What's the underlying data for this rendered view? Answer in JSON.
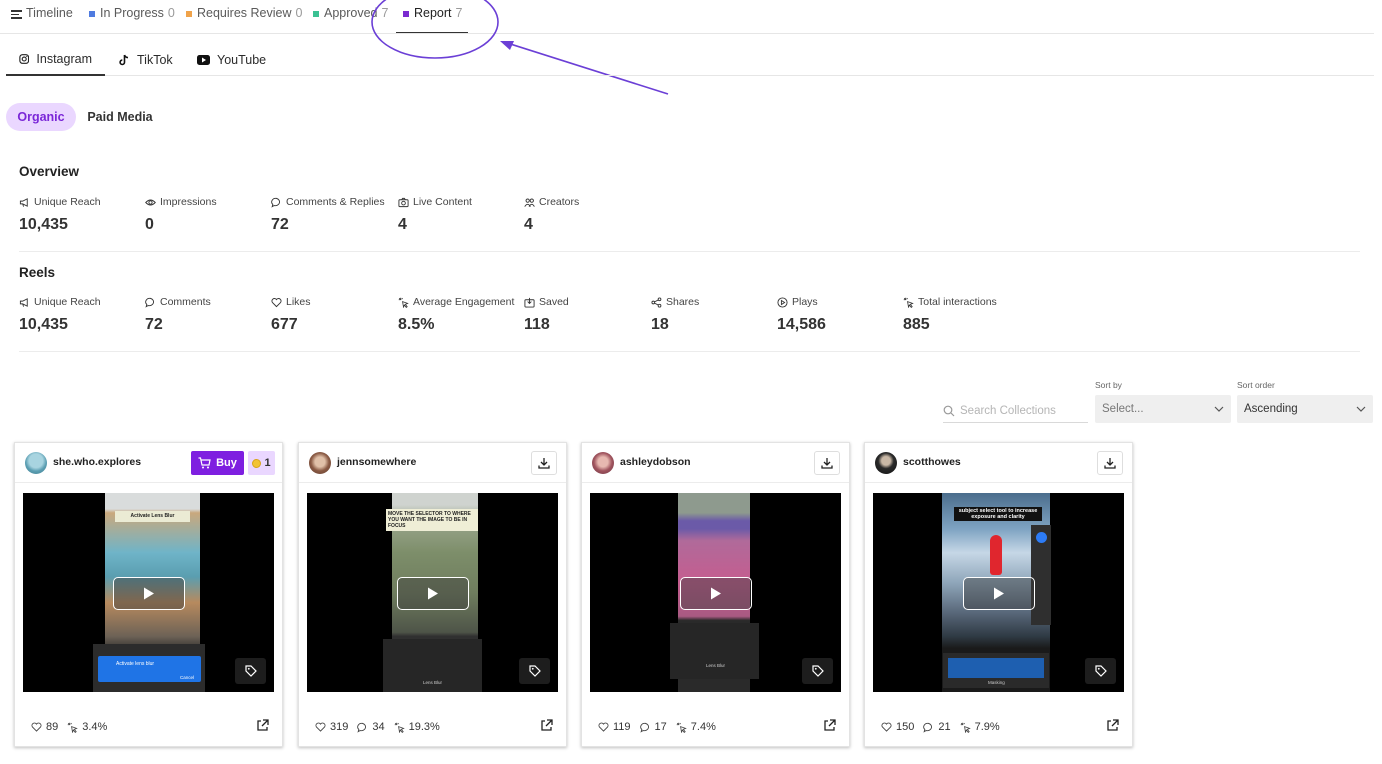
{
  "top_tabs": [
    {
      "label": "Timeline",
      "count": ""
    },
    {
      "label": "In Progress",
      "count": "0",
      "color": "#4f7be0"
    },
    {
      "label": "Requires Review",
      "count": "0",
      "color": "#f0a34a"
    },
    {
      "label": "Approved",
      "count": "7",
      "color": "#3bc193"
    },
    {
      "label": "Report",
      "count": "7",
      "color": "#7a2ad0"
    }
  ],
  "platform_tabs": [
    "Instagram",
    "TikTok",
    "YouTube"
  ],
  "media_pills": [
    "Organic",
    "Paid Media"
  ],
  "overview": {
    "title": "Overview",
    "metrics": [
      {
        "label": "Unique Reach",
        "value": "10,435",
        "icon": "megaphone-icon"
      },
      {
        "label": "Impressions",
        "value": "0",
        "icon": "eye-icon"
      },
      {
        "label": "Comments & Replies",
        "value": "72",
        "icon": "comment-icon"
      },
      {
        "label": "Live Content",
        "value": "4",
        "icon": "camera-icon"
      },
      {
        "label": "Creators",
        "value": "4",
        "icon": "people-icon"
      }
    ]
  },
  "reels": {
    "title": "Reels",
    "metrics": [
      {
        "label": "Unique Reach",
        "value": "10,435",
        "icon": "megaphone-icon"
      },
      {
        "label": "Comments",
        "value": "72",
        "icon": "comment-icon"
      },
      {
        "label": "Likes",
        "value": "677",
        "icon": "heart-icon"
      },
      {
        "label": "Average Engagement",
        "value": "8.5%",
        "icon": "click-icon"
      },
      {
        "label": "Saved",
        "value": "118",
        "icon": "save-icon"
      },
      {
        "label": "Shares",
        "value": "18",
        "icon": "share-icon"
      },
      {
        "label": "Plays",
        "value": "14,586",
        "icon": "play-circle-icon"
      },
      {
        "label": "Total interactions",
        "value": "885",
        "icon": "click-icon"
      }
    ]
  },
  "filters": {
    "search_placeholder": "Search Collections",
    "sort_by_label": "Sort by",
    "sort_by_value": "Select...",
    "sort_order_label": "Sort order",
    "sort_order_value": "Ascending"
  },
  "cards": [
    {
      "username": "she.who.explores",
      "buy_label": "Buy",
      "coin_count": "1",
      "likes": "89",
      "comments": "",
      "engagement": "3.4%",
      "overlay": "Activate Lens Blur",
      "overlay2": "Activate lens blur",
      "overlay3": "Cancel",
      "avatar_color": "#7bb4c8"
    },
    {
      "username": "jennsomewhere",
      "likes": "319",
      "comments": "34",
      "engagement": "19.3%",
      "overlay": "MOVE THE SELECTOR TO WHERE YOU WANT THE IMAGE TO BE IN FOCUS",
      "overlay2": "Lens Blur",
      "avatar_color": "#a57a62"
    },
    {
      "username": "ashleydobson",
      "likes": "119",
      "comments": "17",
      "engagement": "7.4%",
      "overlay": "",
      "overlay2": "Lens Blur",
      "avatar_color": "#b86a7a"
    },
    {
      "username": "scotthowes",
      "likes": "150",
      "comments": "21",
      "engagement": "7.9%",
      "overlay": "subject select tool to increase exposure and clarity",
      "overlay2": "Masking",
      "avatar_color": "#333333"
    }
  ]
}
